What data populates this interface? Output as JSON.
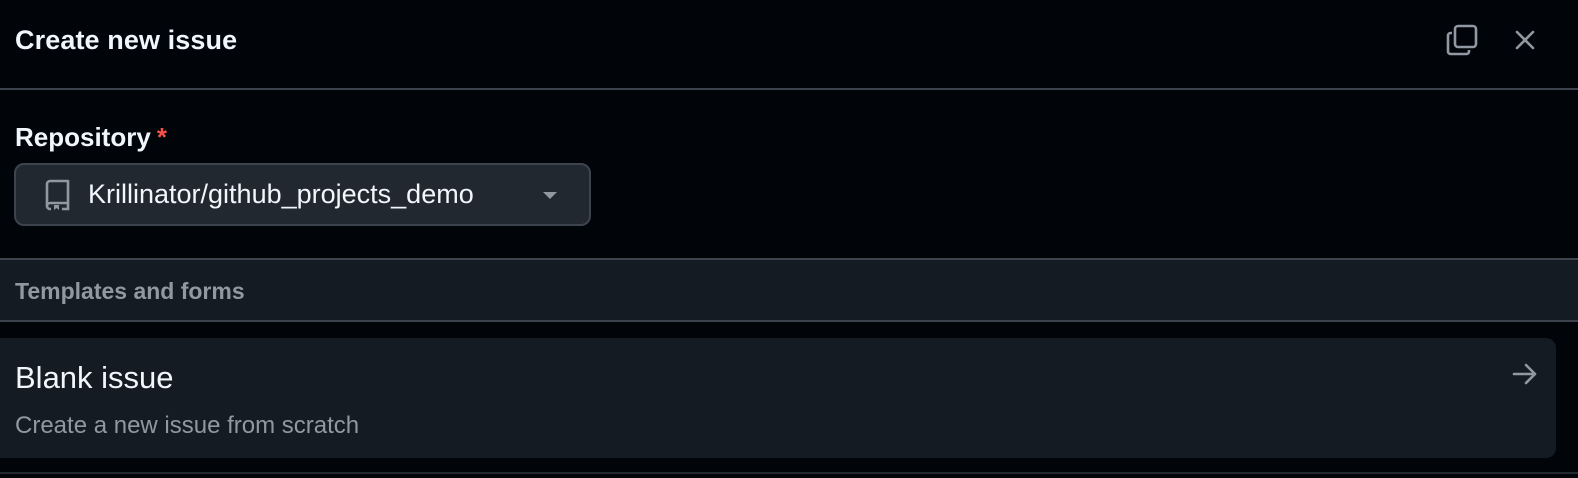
{
  "dialog": {
    "title": "Create new issue",
    "copy_icon": "copy-icon",
    "close_icon": "close-icon"
  },
  "repository": {
    "label": "Repository",
    "required_marker": "*",
    "selected": "Krillinator/github_projects_demo",
    "icon": "repo-icon",
    "dropdown_icon": "caret-down-icon"
  },
  "templates": {
    "section_title": "Templates and forms",
    "items": [
      {
        "title": "Blank issue",
        "description": "Create a new issue from scratch",
        "icon": "arrow-right-icon"
      }
    ]
  },
  "colors": {
    "background": "#010409",
    "surface": "#151b23",
    "border": "#3d444d",
    "text": "#f0f6fc",
    "muted": "#9198a1",
    "danger": "#f85149"
  }
}
